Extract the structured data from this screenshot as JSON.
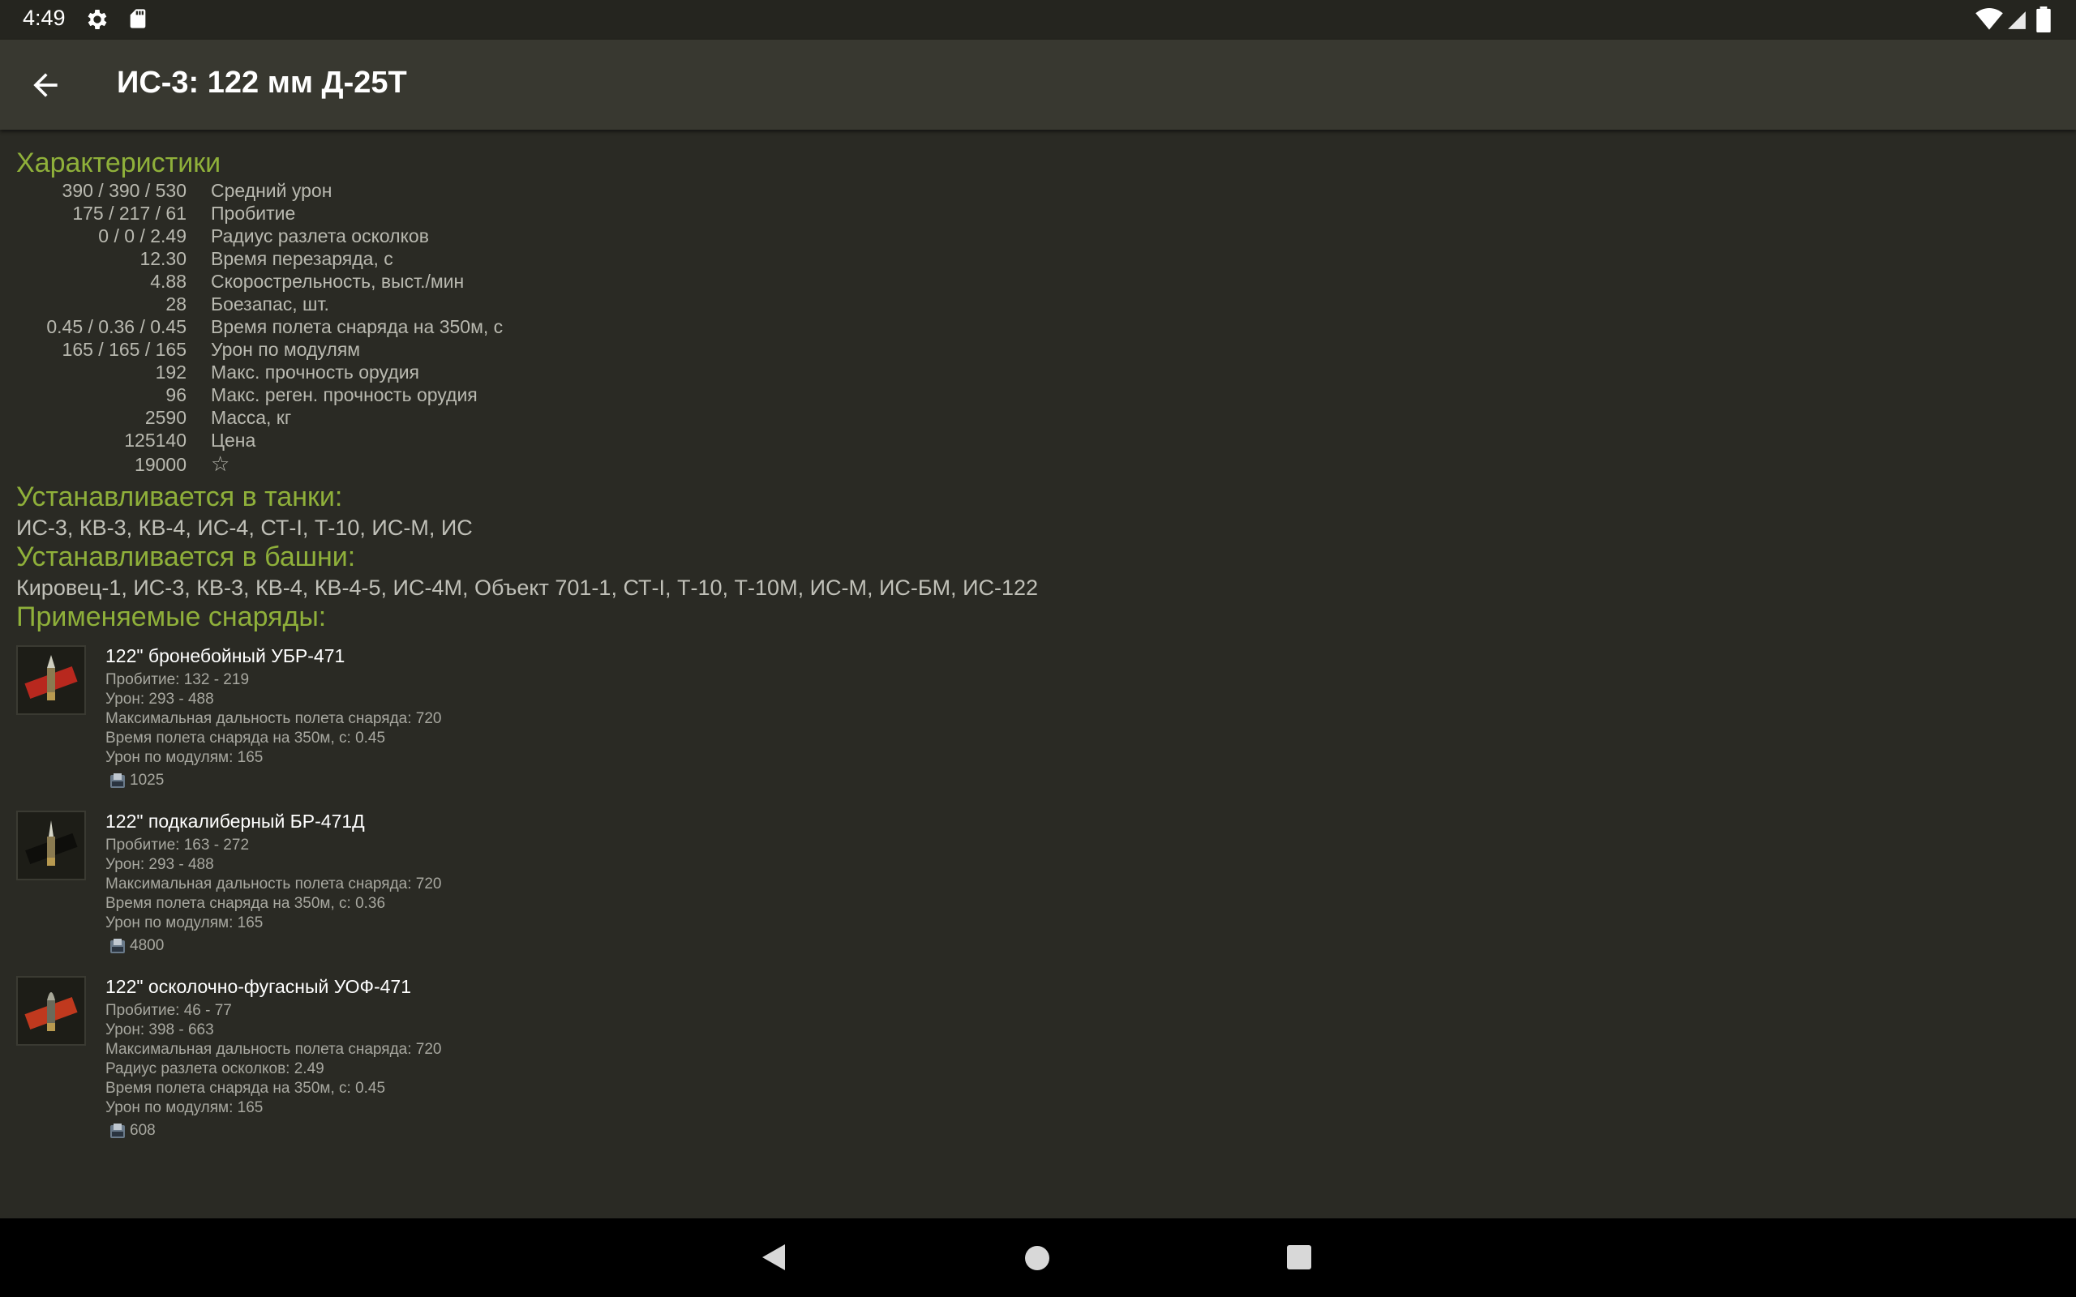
{
  "status_bar": {
    "time": "4:49"
  },
  "app_bar": {
    "title": "ИС-3: 122 мм Д-25Т"
  },
  "specs_section": {
    "title": "Характеристики",
    "rows": [
      {
        "value": "390 / 390 / 530",
        "label": "Средний урон"
      },
      {
        "value": "175 / 217 / 61",
        "label": "Пробитие"
      },
      {
        "value": "0 / 0 / 2.49",
        "label": "Радиус разлета осколков"
      },
      {
        "value": "12.30",
        "label": "Время перезаряда, с"
      },
      {
        "value": "4.88",
        "label": "Скорострельность, выст./мин"
      },
      {
        "value": "28",
        "label": "Боезапас, шт."
      },
      {
        "value": "0.45 / 0.36 / 0.45",
        "label": "Время полета снаряда на 350м, с"
      },
      {
        "value": "165 / 165 / 165",
        "label": "Урон по модулям"
      },
      {
        "value": "192",
        "label": "Макс. прочность орудия"
      },
      {
        "value": "96",
        "label": "Макс. реген. прочность орудия"
      },
      {
        "value": "2590",
        "label": "Масса, кг"
      },
      {
        "value": "125140",
        "label": "Цена"
      },
      {
        "value": "19000",
        "label": "☆"
      }
    ]
  },
  "tanks_section": {
    "title": "Устанавливается в танки:",
    "text": "ИС-3, КВ-3, КВ-4, ИС-4, СТ-I, Т-10, ИС-М, ИС"
  },
  "turrets_section": {
    "title": "Устанавливается в башни:",
    "text": "Кировец-1, ИС-3, КВ-3, КВ-4, КВ-4-5, ИС-4М, Объект 701-1, СТ-I, Т-10, Т-10М, ИС-М, ИС-БМ, ИС-122"
  },
  "shells_section": {
    "title": "Применяемые снаряды:",
    "shells": [
      {
        "name": "122\" бронебойный УБР-471",
        "details": [
          "Пробитие: 132 - 219",
          "Урон: 293 - 488",
          "Максимальная дальность полета снаряда: 720",
          "Время полета снаряда на 350м, с: 0.45",
          "Урон по модулям: 165"
        ],
        "price": "1025",
        "stripe_color": "#b8281e"
      },
      {
        "name": "122\" подкалиберный БР-471Д",
        "details": [
          "Пробитие: 163 - 272",
          "Урон: 293 - 488",
          "Максимальная дальность полета снаряда: 720",
          "Время полета снаряда на 350м, с: 0.36",
          "Урон по модулям: 165"
        ],
        "price": "4800",
        "stripe_color": "#1a1a16"
      },
      {
        "name": "122\" осколочно-фугасный УОФ-471",
        "details": [
          "Пробитие: 46 - 77",
          "Урон: 398 - 663",
          "Максимальная дальность полета снаряда: 720",
          "Радиус разлета осколков: 2.49",
          "Время полета снаряда на 350м, с: 0.45",
          "Урон по модулям: 165"
        ],
        "price": "608",
        "stripe_color": "#c0391e"
      }
    ]
  },
  "colors": {
    "accent": "#8fb03a",
    "background": "#2a2a24",
    "app_bar": "#383830"
  }
}
